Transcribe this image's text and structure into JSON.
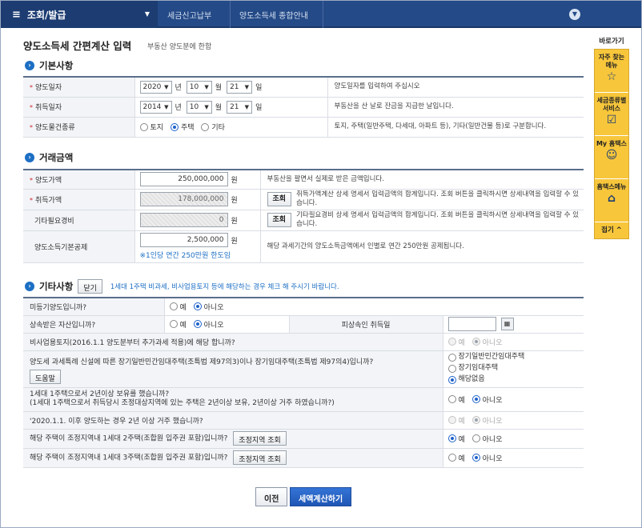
{
  "topbar": {
    "menu": "조회/발급",
    "crumb1": "세금신고납부",
    "crumb2": "양도소득세 종합안내"
  },
  "page": {
    "title": "양도소득세 간편계산 입력",
    "subtitle": "부동산 양도분에 한함"
  },
  "basic": {
    "title": "기본사항",
    "rows": [
      {
        "label": "양도일자",
        "year": "2020",
        "month": "10",
        "day": "21",
        "desc": "양도일자를 입력하여 주십시오"
      },
      {
        "label": "취득일자",
        "year": "2014",
        "month": "10",
        "day": "21",
        "desc": "부동산을 산 날로 잔금을 지급한 날입니다."
      }
    ],
    "type_label": "양도물건종류",
    "type_options": [
      "토지",
      "주택",
      "기타"
    ],
    "type_desc": "토지, 주택(일반주택, 다세대, 아파트 등), 기타(일반건물 등)로 구분합니다.",
    "units": {
      "year": "년",
      "month": "월",
      "day": "일"
    }
  },
  "trade": {
    "title": "거래금액",
    "won": "원",
    "lookup": "조회",
    "sale_label": "양도가액",
    "sale_value": "250,000,000",
    "sale_desc": "부동산을 팔면서 실제로 받은 금액입니다.",
    "acq_label": "취득가액",
    "acq_value": "178,000,000",
    "acq_desc": "취득가액계산 상세 명세서 입력금액의 합계입니다. 조회 버튼을 클릭하시면 상세내역을 입력할 수 있습니다.",
    "exp_label": "기타필요경비",
    "exp_value": "0",
    "exp_desc": "기타필요경비 상세 명세서 입력금액의 합계입니다. 조회 버튼을 클릭하시면 상세내역을 입력할 수 있습니다.",
    "ded_label": "양도소득기본공제",
    "ded_value": "2,500,000",
    "ded_note": "※1인당 연간 250만원 한도임",
    "ded_desc": "해당 과세기간의 양도소득금액에서 인별로 연간 250만원 공제됩니다."
  },
  "other": {
    "title": "기타사항",
    "close_btn": "닫기",
    "notice": "1세대 1주택 비과세, 비사업용토지 등에 해당하는 경우 체크 해 주시기 바랍니다.",
    "yes": "예",
    "no": "아니오",
    "q1": "미등기양도입니까?",
    "q2": "상속받은 자산입니까?",
    "q2_extra": "피상속인 취득일",
    "q3": "비사업용토지(2016.1.1 양도분부터 추가과세 적용)에 해당 합니까?",
    "q4": "양도세 과세특례 신설에 따른 장기일반민간임대주택(조특법 제97의3)이나 장기임대주택(조특법 제97의4)입니까?",
    "q4_help": "도움말",
    "q4_options": [
      "장기일반민간임대주택",
      "장기임대주택",
      "해당없음"
    ],
    "q5_line1": "1세대 1주택으로서 2년이상 보유를 했습니까?",
    "q5_line2": "(1세대 1주택으로서 취득당시 조정대상지역에 있는 주택은 2년이상 보유, 2년이상 거주 하였습니까?)",
    "q6": "'2020.1.1. 이후 양도하는 경우 2년 이상 거주 했습니까?",
    "q7": "해당 주택이 조정지역내 1세대 2주택(조합원 입주권 포함)입니까?",
    "q8": "해당 주택이 조정지역내 1세대 3주택(조합원 입주권 포함)입니까?",
    "region_btn": "조정지역 조회"
  },
  "buttons": {
    "prev": "이전",
    "calc": "세액계산하기"
  },
  "sidebar": {
    "title": "바로가기",
    "items": [
      {
        "label": "자주 찾는 메뉴",
        "icon": "star-icon"
      },
      {
        "label": "세금종류별 서비스",
        "icon": "check-icon"
      },
      {
        "label": "My 홈택스",
        "icon": "user-icon"
      },
      {
        "label": "홈택스메뉴",
        "icon": "home-icon"
      }
    ],
    "fold": "접기"
  },
  "colors": {
    "primary": "#244a87",
    "accent": "#1d6fc4",
    "sidebar": "#f7c63b",
    "required": "#d1202a"
  }
}
